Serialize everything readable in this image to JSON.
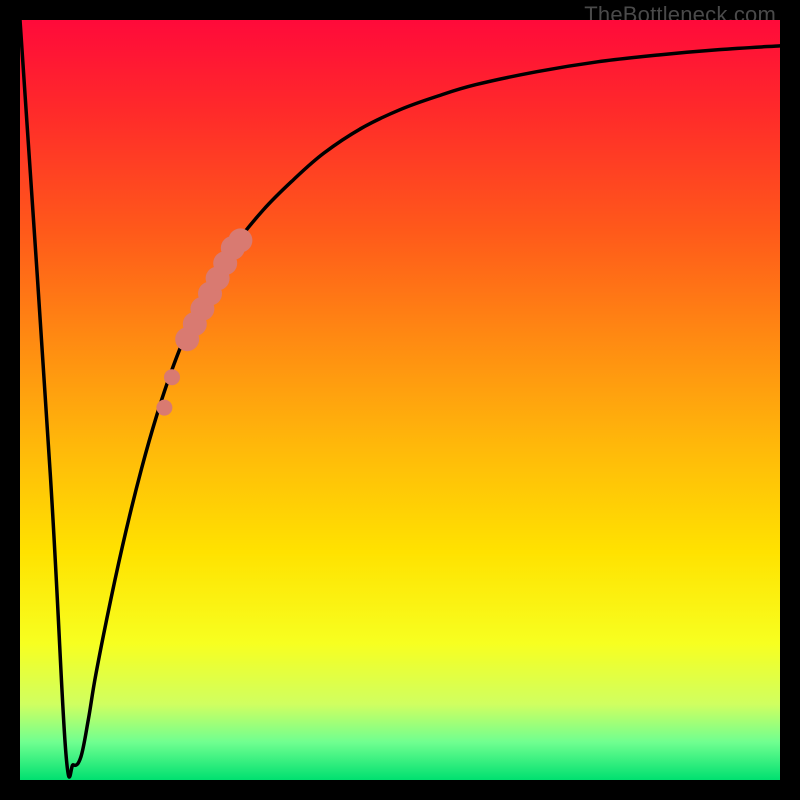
{
  "watermark": "TheBottleneck.com",
  "colors": {
    "curve": "#000000",
    "marker": "#d97a71"
  },
  "chart_data": {
    "type": "line",
    "title": "",
    "xlabel": "",
    "ylabel": "",
    "xlim": [
      0,
      100
    ],
    "ylim": [
      0,
      100
    ],
    "grid": false,
    "legend": false,
    "x": [
      0,
      4,
      6,
      7,
      8,
      9,
      10,
      12,
      14,
      16,
      18,
      20,
      22,
      25,
      28,
      32,
      36,
      40,
      45,
      50,
      55,
      60,
      68,
      76,
      84,
      92,
      100
    ],
    "values": [
      100,
      40,
      4,
      2,
      3,
      8,
      14,
      24,
      33,
      41,
      48,
      54,
      59,
      65,
      70,
      75,
      79,
      82.5,
      85.8,
      88.2,
      90.0,
      91.5,
      93.2,
      94.5,
      95.4,
      96.1,
      96.6
    ],
    "markers": {
      "x": [
        19,
        20,
        22,
        23,
        24,
        25,
        26,
        27,
        28,
        29
      ],
      "values": [
        49,
        53,
        58,
        60,
        62,
        64,
        66,
        68,
        70,
        71
      ],
      "size": [
        8,
        8,
        12,
        12,
        12,
        12,
        12,
        12,
        12,
        12
      ]
    },
    "note": "No axes, ticks, or numeric labels are rendered. Values estimated from geometry on a 0–100 normalized scale."
  }
}
